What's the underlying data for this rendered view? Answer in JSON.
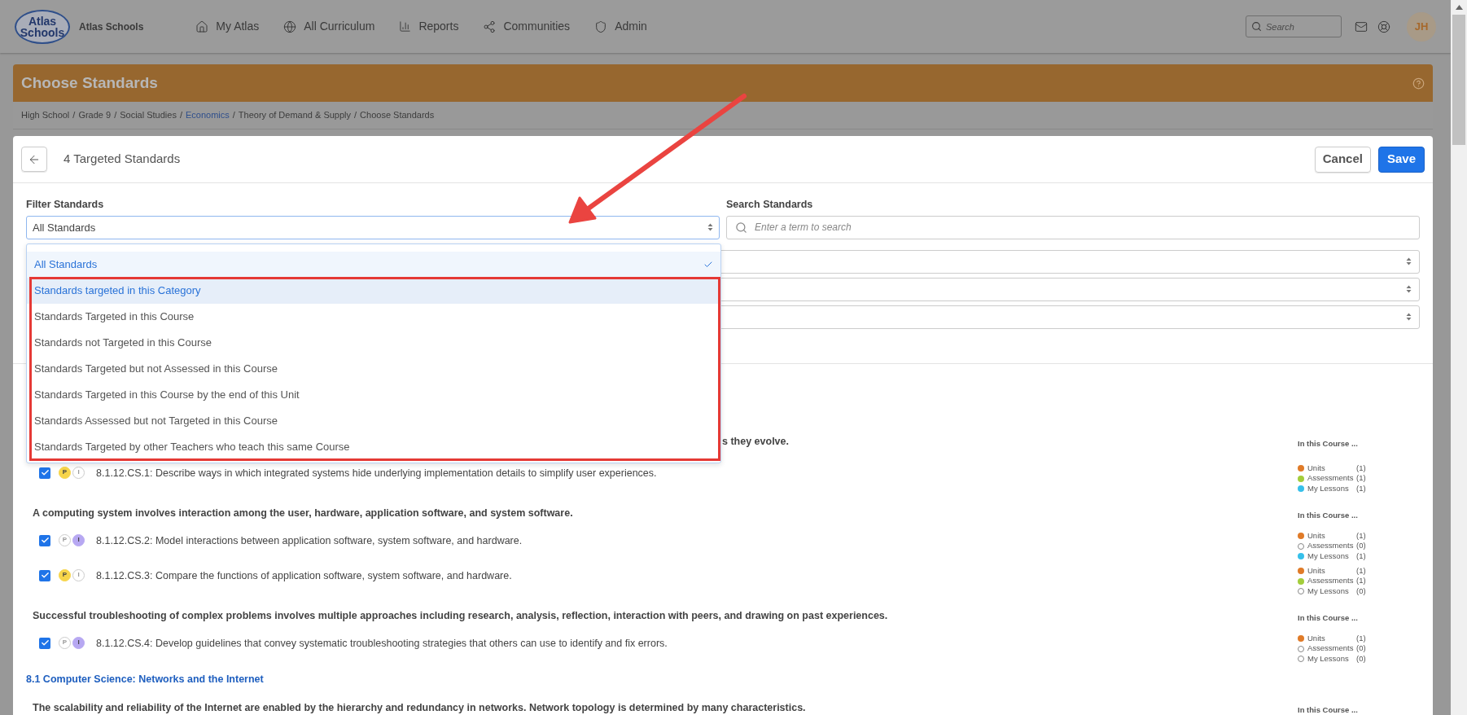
{
  "top_bar": {
    "logo_lines": [
      "Atlas",
      "Schools"
    ],
    "org_name": "Atlas Schools",
    "nav": [
      {
        "kind": "home",
        "label": "My Atlas"
      },
      {
        "kind": "globe",
        "label": "All Curriculum"
      },
      {
        "kind": "reports",
        "label": "Reports"
      },
      {
        "kind": "communities",
        "label": "Communities"
      },
      {
        "kind": "admin",
        "label": "Admin"
      }
    ],
    "search": {
      "placeholder": "Search"
    },
    "avatar": "JH"
  },
  "page_header": {
    "title": "Choose Standards",
    "breadcrumb": [
      {
        "label": "High School",
        "link": false
      },
      {
        "label": "Grade 9",
        "link": false
      },
      {
        "label": "Social Studies",
        "link": false
      },
      {
        "label": "Economics",
        "link": true
      },
      {
        "label": "Theory of Demand & Supply",
        "link": false
      },
      {
        "label": "Choose Standards",
        "link": false
      }
    ],
    "separator": "/"
  },
  "modal": {
    "title": "4 Targeted Standards",
    "buttons": [
      {
        "kind": "secondary",
        "label": "Cancel"
      },
      {
        "kind": "primary",
        "label": "Save"
      }
    ],
    "filter": {
      "label": "Filter Standards",
      "value": "All Standards",
      "open": true,
      "options": [
        {
          "label": "All Standards",
          "selected": true,
          "highlighted": false
        },
        {
          "label": "Standards targeted in this Category",
          "selected": false,
          "highlighted": true
        },
        {
          "label": "Standards Targeted in this Course",
          "selected": false,
          "highlighted": false
        },
        {
          "label": "Standards not Targeted in this Course",
          "selected": false,
          "highlighted": false
        },
        {
          "label": "Standards Targeted but not Assessed in this Course",
          "selected": false,
          "highlighted": false
        },
        {
          "label": "Standards Targeted in this Course by the end of this Unit",
          "selected": false,
          "highlighted": false
        },
        {
          "label": "Standards Assessed but not Targeted in this Course",
          "selected": false,
          "highlighted": false
        },
        {
          "label": "Standards Targeted by other Teachers who teach this same Course",
          "selected": false,
          "highlighted": false
        }
      ]
    },
    "search": {
      "label": "Search Standards",
      "placeholder": "Enter a term to search"
    },
    "content": [
      {
        "kind": "heading",
        "text": "s they evolve.",
        "clipped": true,
        "legend_title": "In this Course ..."
      },
      {
        "kind": "standard",
        "checked": true,
        "badges": [
          {
            "label": "P",
            "on": true
          },
          {
            "label": "I",
            "on": false
          }
        ],
        "text": "8.1.12.CS.1: Describe ways in which integrated systems hide underlying implementation details to simplify user experiences.",
        "legend": [
          {
            "label": "Units",
            "count": "(1)",
            "filled": true,
            "color": "#e07b28"
          },
          {
            "label": "Assessments",
            "count": "(1)",
            "filled": true,
            "color": "#a3cd3b"
          },
          {
            "label": "My Lessons",
            "count": "(1)",
            "filled": true,
            "color": "#36c0ea"
          }
        ]
      },
      {
        "kind": "heading",
        "text": "A computing system involves interaction among the user, hardware, application software, and system software.",
        "legend_title": "In this Course ..."
      },
      {
        "kind": "standard",
        "checked": true,
        "badges": [
          {
            "label": "P",
            "on": false
          },
          {
            "label": "I",
            "on": true
          }
        ],
        "text": "8.1.12.CS.2: Model interactions between application software, system software, and hardware.",
        "legend": [
          {
            "label": "Units",
            "count": "(1)",
            "filled": true,
            "color": "#e07b28"
          },
          {
            "label": "Assessments",
            "count": "(0)",
            "filled": false
          },
          {
            "label": "My Lessons",
            "count": "(1)",
            "filled": true,
            "color": "#36c0ea"
          }
        ]
      },
      {
        "kind": "standard",
        "checked": true,
        "badges": [
          {
            "label": "P",
            "on": true
          },
          {
            "label": "I",
            "on": false
          }
        ],
        "text": "8.1.12.CS.3: Compare the functions of application software, system software, and hardware.",
        "legend": [
          {
            "label": "Units",
            "count": "(1)",
            "filled": true,
            "color": "#e07b28"
          },
          {
            "label": "Assessments",
            "count": "(1)",
            "filled": true,
            "color": "#a3cd3b"
          },
          {
            "label": "My Lessons",
            "count": "(0)",
            "filled": false
          }
        ]
      },
      {
        "kind": "heading",
        "text": "Successful troubleshooting of complex problems involves multiple approaches including research, analysis, reflection, interaction with peers, and drawing on past experiences.",
        "legend_title": "In this Course ..."
      },
      {
        "kind": "standard",
        "checked": true,
        "badges": [
          {
            "label": "P",
            "on": false
          },
          {
            "label": "I",
            "on": true
          }
        ],
        "text": "8.1.12.CS.4: Develop guidelines that convey systematic troubleshooting strategies that others can use to identify and fix errors.",
        "legend": [
          {
            "label": "Units",
            "count": "(1)",
            "filled": true,
            "color": "#e07b28"
          },
          {
            "label": "Assessments",
            "count": "(0)",
            "filled": false
          },
          {
            "label": "My Lessons",
            "count": "(0)",
            "filled": false
          }
        ]
      },
      {
        "kind": "category",
        "text": "8.1 Computer Science: Networks and the Internet"
      },
      {
        "kind": "heading",
        "text": "The scalability and reliability of the Internet are enabled by the hierarchy and redundancy in networks. Network topology is determined by many characteristics.",
        "legend_title": "In this Course ..."
      }
    ]
  }
}
